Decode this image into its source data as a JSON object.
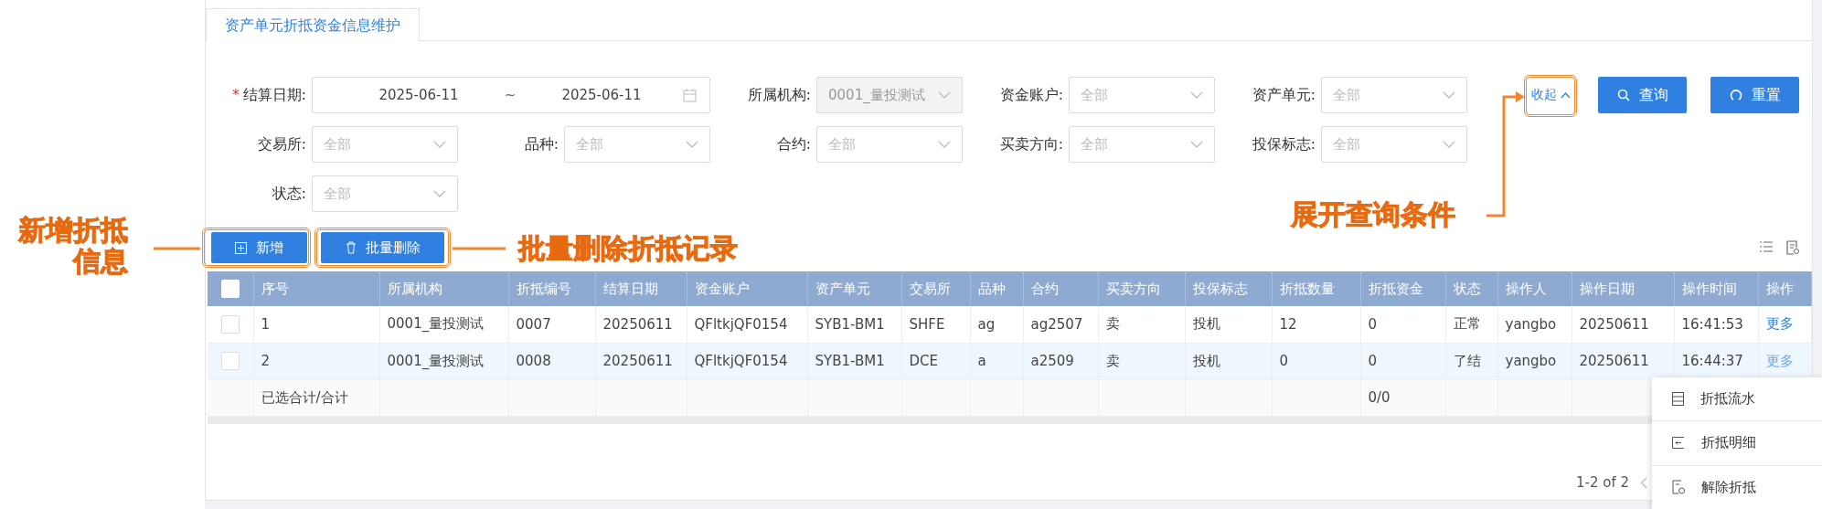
{
  "tab": {
    "label": "资产单元折抵资金信息维护",
    "selected": true
  },
  "filters": [
    {
      "kind": "daterange",
      "label": "结算日期:",
      "required_mark": "*",
      "start": "2025-06-11",
      "separator": "~",
      "end": "2025-06-11"
    },
    {
      "kind": "select",
      "label": "所属机构:",
      "value": "0001_量投测试",
      "disabled": true
    },
    {
      "kind": "select",
      "label": "资金账户:",
      "placeholder": "全部",
      "disabled": false
    },
    {
      "kind": "select",
      "label": "资产单元:",
      "placeholder": "全部",
      "disabled": false
    },
    {
      "kind": "select",
      "label": "交易所:",
      "placeholder": "全部",
      "disabled": false
    },
    {
      "kind": "select",
      "label": "品种:",
      "placeholder": "全部",
      "disabled": false
    },
    {
      "kind": "select",
      "label": "合约:",
      "placeholder": "全部",
      "disabled": false
    },
    {
      "kind": "select",
      "label": "买卖方向:",
      "placeholder": "全部",
      "disabled": false
    },
    {
      "kind": "select",
      "label": "投保标志:",
      "placeholder": "全部",
      "disabled": false
    },
    {
      "kind": "select",
      "label": "状态:",
      "placeholder": "全部",
      "disabled": false
    }
  ],
  "collapse_link": {
    "label": "收起",
    "expanded": true
  },
  "search_buttons": [
    {
      "kind": "search",
      "label": "查询"
    },
    {
      "kind": "reset",
      "label": "重置"
    }
  ],
  "toolbar_buttons": [
    {
      "kind": "add",
      "label": "新增"
    },
    {
      "kind": "delete",
      "label": "批量删除"
    }
  ],
  "table": {
    "all_checked": false,
    "columns": [
      "序号",
      "所属机构",
      "折抵编号",
      "结算日期",
      "资金账户",
      "资产单元",
      "交易所",
      "品种",
      "合约",
      "买卖方向",
      "投保标志",
      "折抵数量",
      "折抵资金",
      "状态",
      "操作人",
      "操作日期",
      "操作时间",
      "操作"
    ],
    "rows": [
      {
        "selected": false,
        "hovered": false,
        "cells": [
          "1",
          "0001_量投测试",
          "0007",
          "20250611",
          "QFltkjQF0154",
          "SYB1-BM1",
          "SHFE",
          "ag",
          "ag2507",
          "卖",
          "投机",
          "12",
          "0",
          "正常",
          "yangbo",
          "20250611",
          "16:41:53"
        ],
        "action": "更多"
      },
      {
        "selected": false,
        "hovered": true,
        "cells": [
          "2",
          "0001_量投测试",
          "0008",
          "20250611",
          "QFltkjQF0154",
          "SYB1-BM1",
          "DCE",
          "a",
          "a2509",
          "卖",
          "投机",
          "0",
          "0",
          "了结",
          "yangbo",
          "20250611",
          "16:44:37"
        ],
        "action": "更多"
      }
    ],
    "summary": {
      "label": "已选合计/合计",
      "fund": "0/0"
    }
  },
  "pagination": {
    "range": "1-2 of 2"
  },
  "action_menu": [
    {
      "kind": "flow",
      "label": "折抵流水"
    },
    {
      "kind": "detail",
      "label": "折抵明细"
    },
    {
      "kind": "release",
      "label": "解除折抵"
    }
  ],
  "annotations": [
    {
      "kind": "add",
      "text": "新增折抵信息"
    },
    {
      "kind": "delete",
      "text": "批量删除折抵记录"
    },
    {
      "kind": "expand",
      "text": "展开查询条件"
    }
  ]
}
